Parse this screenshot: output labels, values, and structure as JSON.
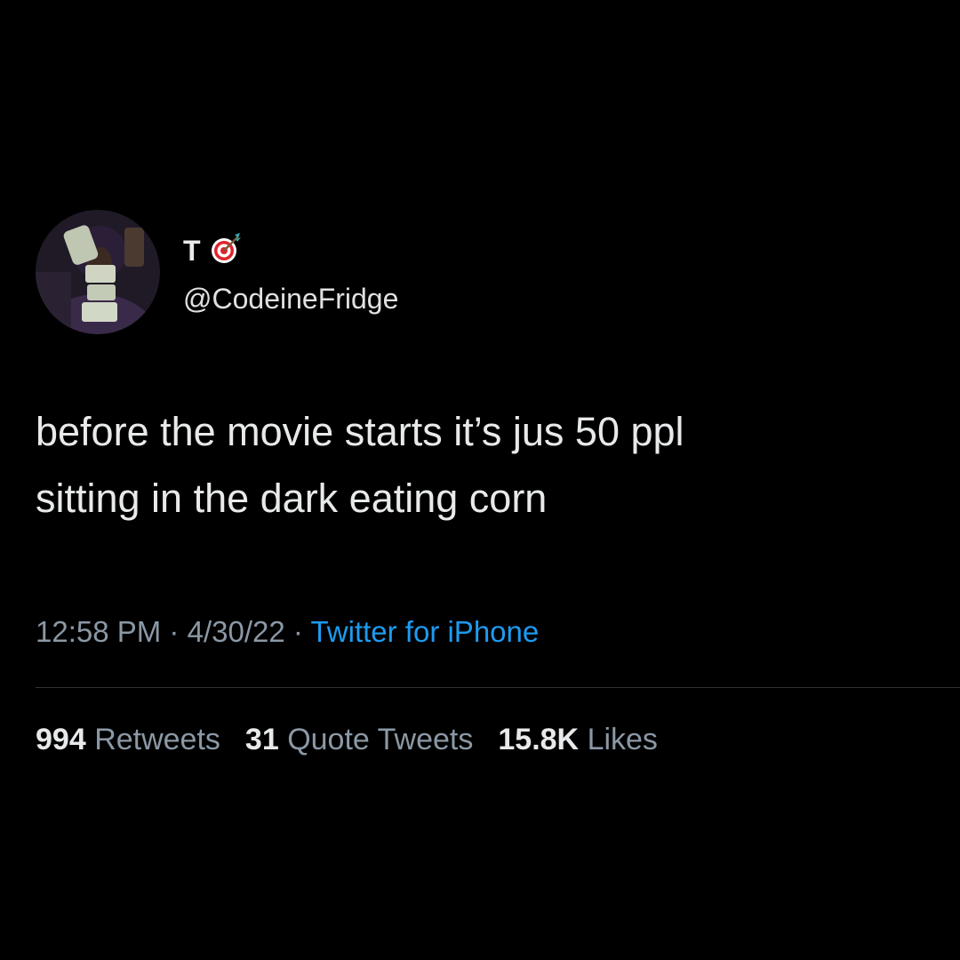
{
  "author": {
    "display_name": "T",
    "emoji_icon": "direct-hit-target-emoji",
    "handle": "@CodeineFridge"
  },
  "tweet": {
    "text": "before the movie starts it’s jus 50 ppl\nsitting in the dark eating corn"
  },
  "meta": {
    "time": "12:58 PM",
    "separator": "·",
    "date": "4/30/22",
    "source": "Twitter for iPhone"
  },
  "stats": {
    "retweets_count": "994",
    "retweets_label": "Retweets",
    "quotes_count": "31",
    "quotes_label": "Quote Tweets",
    "likes_count": "15.8K",
    "likes_label": "Likes"
  },
  "colors": {
    "background": "#000000",
    "text_primary": "#e7e9ea",
    "text_secondary": "#8b98a5",
    "link_blue": "#1d9bf0",
    "divider": "#2f3336"
  }
}
